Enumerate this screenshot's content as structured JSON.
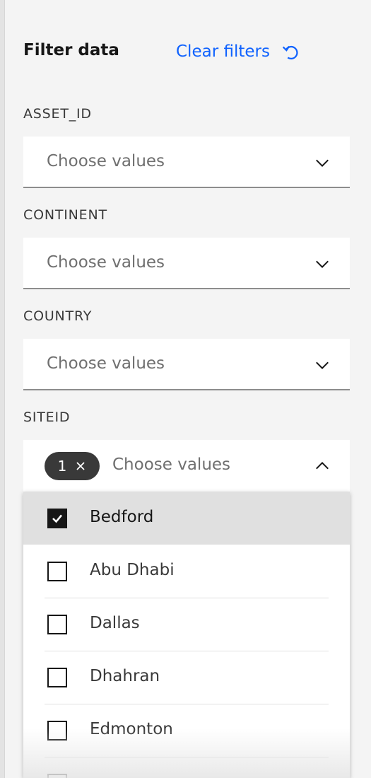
{
  "header": {
    "title": "Filter data",
    "clear_label": "Clear filters"
  },
  "filters": [
    {
      "label": "ASSET_ID",
      "placeholder": "Choose values"
    },
    {
      "label": "CONTINENT",
      "placeholder": "Choose values"
    },
    {
      "label": "COUNTRY",
      "placeholder": "Choose values"
    },
    {
      "label": "SITEID",
      "placeholder": "Choose values",
      "selected_count": "1"
    }
  ],
  "siteid_options": [
    {
      "label": "Bedford",
      "checked": true
    },
    {
      "label": "Abu Dhabi",
      "checked": false
    },
    {
      "label": "Dallas",
      "checked": false
    },
    {
      "label": "Dhahran",
      "checked": false
    },
    {
      "label": "Edmonton",
      "checked": false
    }
  ],
  "colors": {
    "accent": "#0f62fe",
    "tag_bg": "#393939",
    "selected_row": "#e0e0e0"
  }
}
